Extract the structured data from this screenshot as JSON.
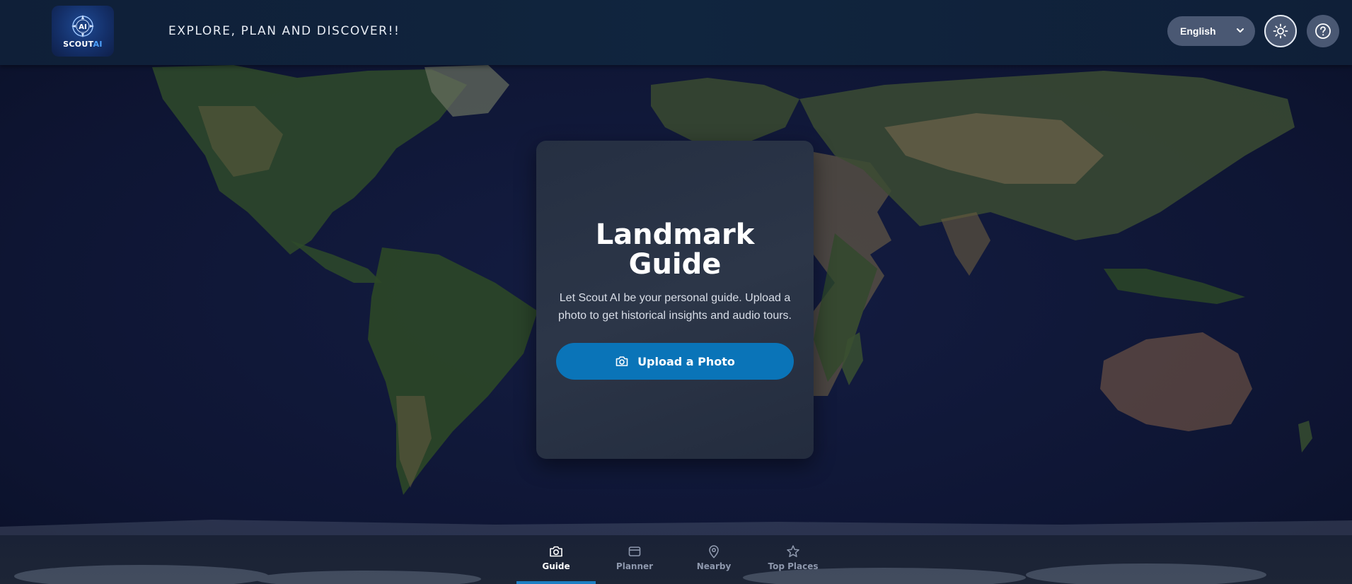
{
  "header": {
    "logo": {
      "brand_name": "SCOUT",
      "brand_suffix": "AI",
      "emblem_text": "AI",
      "icon": "compass-icon"
    },
    "tagline": "EXPLORE, PLAN AND DISCOVER!!",
    "language": {
      "selected": "English",
      "icon": "chevron-down-icon"
    },
    "theme_toggle": {
      "icon": "sun-icon"
    },
    "help": {
      "icon": "question-circle-icon"
    }
  },
  "hero_card": {
    "title_line1": "Landmark",
    "title_line2": "Guide",
    "description_line1": "Let Scout AI be your personal guide. Upload a",
    "description_line2": "photo to get historical insights and audio tours.",
    "upload_button": {
      "label": "Upload a Photo",
      "icon": "camera-icon"
    }
  },
  "bottom_nav": {
    "active": "Guide",
    "items": [
      {
        "label": "Guide",
        "icon": "camera-icon"
      },
      {
        "label": "Planner",
        "icon": "ticket-icon"
      },
      {
        "label": "Nearby",
        "icon": "map-pin-icon"
      },
      {
        "label": "Top Places",
        "icon": "star-icon"
      }
    ]
  },
  "colors": {
    "accent": "#0a74b8",
    "active_tab_underline": "#1e7fc4",
    "header_bg": "#10253e",
    "card_bg": "#2a3446"
  }
}
